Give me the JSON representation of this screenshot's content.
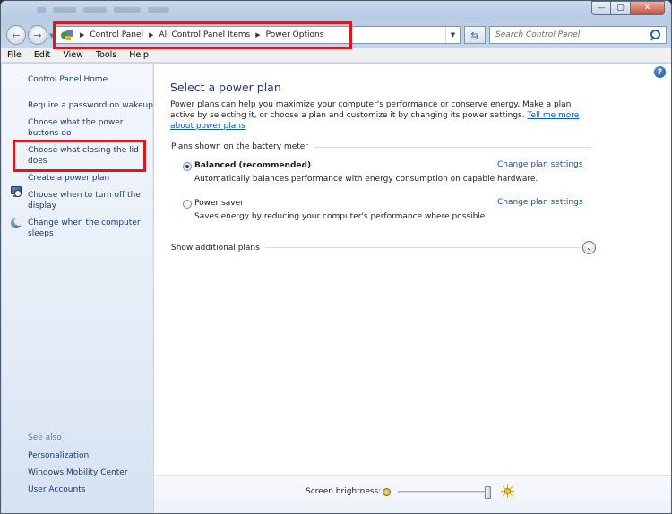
{
  "window": {
    "minimize_glyph": "—",
    "maximize_glyph": "▢",
    "close_glyph": "✕"
  },
  "nav": {
    "back_glyph": "←",
    "forward_glyph": "→",
    "dropdown_glyph": "▼",
    "breadcrumbs": [
      "Control Panel",
      "All Control Panel Items",
      "Power Options"
    ],
    "crumb_separator": "▶",
    "refresh_glyph": "⇆",
    "address_icon": "control-panel-icon"
  },
  "search": {
    "placeholder": "Search Control Panel",
    "icon": "search-icon"
  },
  "menu": [
    "File",
    "Edit",
    "View",
    "Tools",
    "Help"
  ],
  "sidebar": {
    "home": "Control Panel Home",
    "links": [
      "Require a password on wakeup",
      "Choose what the power buttons do",
      "Choose what closing the lid does",
      "Create a power plan",
      "Choose when to turn off the display",
      "Change when the computer sleeps"
    ],
    "see_also_title": "See also",
    "see_also": [
      "Personalization",
      "Windows Mobility Center",
      "User Accounts"
    ]
  },
  "main": {
    "help_glyph": "?",
    "title": "Select a power plan",
    "intro": "Power plans can help you maximize your computer's performance or conserve energy. Make a plan active by selecting it, or choose a plan and customize it by changing its power settings.",
    "intro_link": "Tell me more about power plans",
    "group_title": "Plans shown on the battery meter",
    "plans": [
      {
        "name": "Balanced (recommended)",
        "description": "Automatically balances performance with energy consumption on capable hardware.",
        "link": "Change plan settings",
        "selected": true
      },
      {
        "name": "Power saver",
        "description": "Saves energy by reducing your computer's performance where possible.",
        "link": "Change plan settings",
        "selected": false
      }
    ],
    "additional": "Show additional plans",
    "expand_glyph": "⌄"
  },
  "brightness": {
    "label": "Screen brightness:",
    "level": 1.0
  },
  "colors": {
    "link": "#1e3a6e",
    "title": "#1e3287",
    "annotation": "#e3141b"
  }
}
